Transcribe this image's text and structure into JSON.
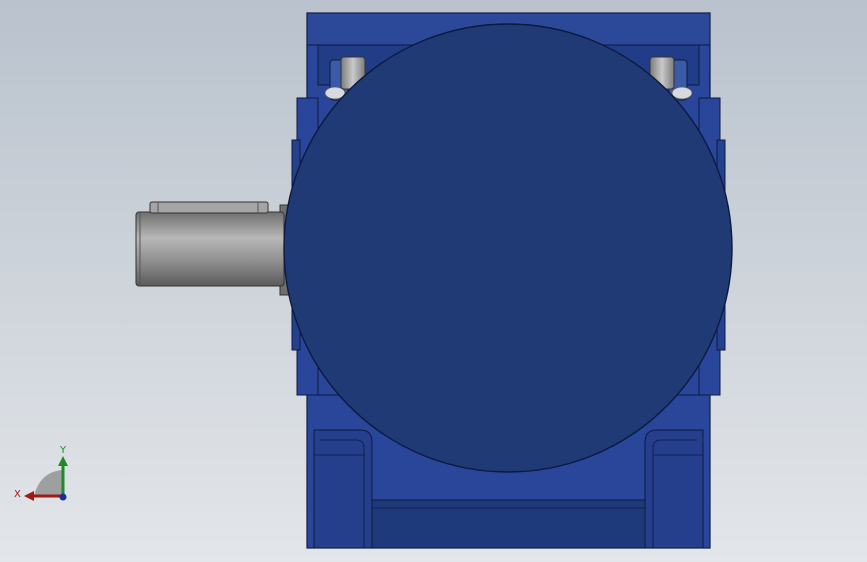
{
  "scene": {
    "model": "worm-gear-reducer",
    "view": "front",
    "colors": {
      "background_top": "#b9c2cd",
      "background_bottom": "#e3e6ea",
      "housing": "#2a469a",
      "housing_dark": "#1f3a7a",
      "edge": "#0c1a3e",
      "shaft": "#8b8b8b",
      "shaft_highlight": "#b4b4b4",
      "key": "#9a9a9a"
    }
  },
  "triad": {
    "x_label": "X",
    "y_label": "Y",
    "colors": {
      "x": "#a01818",
      "y": "#1e8a2a",
      "z": "#1c2c9e"
    }
  }
}
